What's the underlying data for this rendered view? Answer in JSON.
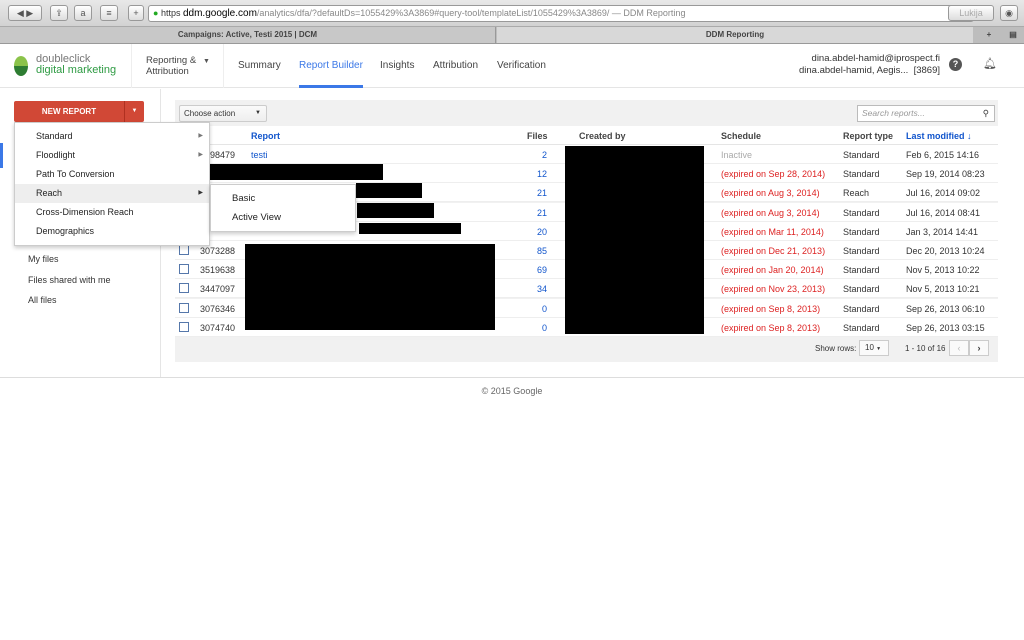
{
  "browser": {
    "url_scheme": "https",
    "url_host": "ddm.google.com",
    "url_path": "/analytics/dfa/?defaultDs=1055429%3A3869#query-tool/templateList/1055429%3A3869/",
    "page_title_suffix": " — DDM Reporting",
    "search_placeholder": "Lukija",
    "tabs": [
      "Campaigns: Active, Testi 2015 | DCM",
      "DDM Reporting"
    ]
  },
  "header": {
    "logo_line1": "doubleclick",
    "logo_line2": "digital marketing",
    "product_line1": "Reporting &",
    "product_line2": "Attribution",
    "nav": [
      "Summary",
      "Report Builder",
      "Insights",
      "Attribution",
      "Verification"
    ],
    "active_nav": "Report Builder",
    "user_email": "dina.abdel-hamid@iprospect.fi",
    "user_account": "dina.abdel-hamid, Aegis...  [3869]"
  },
  "new_report": {
    "label": "NEW REPORT",
    "color": "#d14836"
  },
  "menu": {
    "items": [
      "Standard",
      "Floodlight",
      "Path To Conversion",
      "Reach",
      "Cross-Dimension Reach",
      "Demographics"
    ],
    "highlighted": "Reach",
    "submenu": [
      "Basic",
      "Active View"
    ]
  },
  "sidebar": {
    "items": [
      "My files",
      "Files shared with me",
      "All files"
    ]
  },
  "toolbar": {
    "choose_action": "Choose action",
    "search_placeholder": "Search reports..."
  },
  "table": {
    "headers": {
      "report": "Report",
      "files": "Files",
      "created_by": "Created by",
      "schedule": "Schedule",
      "report_type": "Report type",
      "last_modified": "Last modified ↓"
    },
    "rows": [
      {
        "id": "3998479",
        "name": "testi",
        "files": "2",
        "schedule": "Inactive",
        "type": "Standard",
        "modified": "Feb 6, 2015 14:16"
      },
      {
        "id": "",
        "name": "",
        "files": "12",
        "schedule": "(expired on Sep 28, 2014)",
        "type": "Standard",
        "modified": "Sep 19, 2014 08:23"
      },
      {
        "id": "",
        "name": "",
        "files": "21",
        "schedule": "(expired on Aug 3, 2014)",
        "type": "Reach",
        "modified": "Jul 16, 2014 09:02"
      },
      {
        "id": "",
        "name": "",
        "files": "21",
        "schedule": "(expired on Aug 3, 2014)",
        "type": "Standard",
        "modified": "Jul 16, 2014 08:41"
      },
      {
        "id": "",
        "name": "",
        "files": "20",
        "schedule": "(expired on Mar 11, 2014)",
        "type": "Standard",
        "modified": "Jan 3, 2014 14:41"
      },
      {
        "id": "3073288",
        "name": "",
        "files": "85",
        "schedule": "(expired on Dec 21, 2013)",
        "type": "Standard",
        "modified": "Dec 20, 2013 10:24"
      },
      {
        "id": "3519638",
        "name": "",
        "files": "69",
        "schedule": "(expired on Jan 20, 2014)",
        "type": "Standard",
        "modified": "Nov 5, 2013 10:22"
      },
      {
        "id": "3447097",
        "name": "",
        "files": "34",
        "schedule": "(expired on Nov 23, 2013)",
        "type": "Standard",
        "modified": "Nov 5, 2013 10:21"
      },
      {
        "id": "3076346",
        "name": "",
        "files": "0",
        "schedule": "(expired on Sep 8, 2013)",
        "type": "Standard",
        "modified": "Sep 26, 2013 06:10"
      },
      {
        "id": "3074740",
        "name": "",
        "files": "0",
        "schedule": "(expired on Sep 8, 2013)",
        "type": "Standard",
        "modified": "Sep 26, 2013 03:15"
      }
    ]
  },
  "pagination": {
    "show_rows_label": "Show rows:",
    "rows_value": "10",
    "range": "1 - 10 of 16"
  },
  "footer": {
    "text": "© 2015 Google"
  }
}
